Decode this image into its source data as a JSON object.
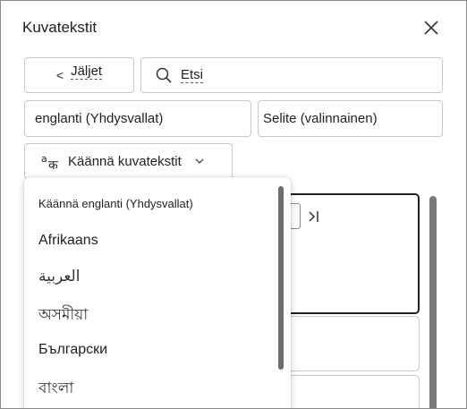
{
  "panel": {
    "title": "Kuvatekstit"
  },
  "toolbar": {
    "back_label": "Jäljet",
    "search_text": "Etsi"
  },
  "fields": {
    "language": "englanti (Yhdysvallat)",
    "description": "Selite (valinnainen)"
  },
  "translate": {
    "label": "Käännä kuvatekstit"
  },
  "dropdown": {
    "header": "Käännä englanti (Yhdysvallat)",
    "items": [
      "Afrikaans",
      "العربية",
      "অসমীয়া",
      "Български",
      "বাংলা"
    ]
  },
  "icons": {
    "close": "close-icon",
    "back": "chevron-left-icon",
    "search": "search-icon",
    "translate": "translate-icon",
    "chevron": "chevron-down-icon",
    "skip": "skip-to-end-icon"
  }
}
